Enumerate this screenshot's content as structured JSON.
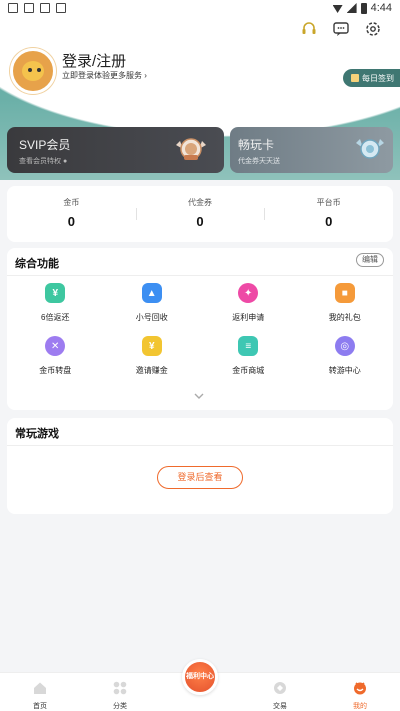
{
  "statusbar": {
    "time": "4:44"
  },
  "profile": {
    "login_title": "登录/注册",
    "login_subtitle": "立即登录体验更多服务",
    "checkin_label": "每日签到"
  },
  "vip_card": {
    "title": "SVIP会员",
    "subtitle": "查看会员特权"
  },
  "play_card": {
    "title": "畅玩卡",
    "subtitle": "代金券天天送"
  },
  "stats": [
    {
      "label": "金币",
      "value": "0"
    },
    {
      "label": "代金券",
      "value": "0"
    },
    {
      "label": "平台币",
      "value": "0"
    }
  ],
  "functions": {
    "title": "综合功能",
    "edit_label": "编辑",
    "items": [
      {
        "label": "6倍返还",
        "icon": "money-bag-icon",
        "color": "#3ec7a0"
      },
      {
        "label": "小号回收",
        "icon": "recycle-icon",
        "color": "#3d8ff2"
      },
      {
        "label": "返利申请",
        "icon": "rebate-icon",
        "color": "#ee4aa6"
      },
      {
        "label": "我的礼包",
        "icon": "gift-icon",
        "color": "#f59a3a"
      },
      {
        "label": "金币转盘",
        "icon": "wheel-icon",
        "color": "#9d7cf0"
      },
      {
        "label": "邀请赚金",
        "icon": "invite-icon",
        "color": "#f2c531"
      },
      {
        "label": "金币商城",
        "icon": "mall-icon",
        "color": "#3ec7b3"
      },
      {
        "label": "转游中心",
        "icon": "transfer-icon",
        "color": "#8d7cf0"
      }
    ]
  },
  "games": {
    "title": "常玩游戏",
    "login_view_label": "登录后查看"
  },
  "tabbar": {
    "center_label": "福利中心",
    "tabs": [
      {
        "label": "首页",
        "icon": "home-icon"
      },
      {
        "label": "分类",
        "icon": "category-icon"
      },
      {
        "label": "",
        "icon": "welfare-icon"
      },
      {
        "label": "交易",
        "icon": "trade-icon"
      },
      {
        "label": "我的",
        "icon": "profile-icon"
      }
    ]
  }
}
